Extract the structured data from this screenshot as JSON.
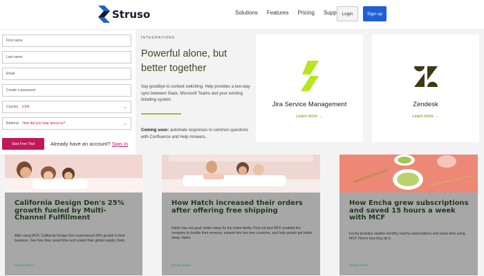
{
  "header": {
    "logo_text": "Struso",
    "nav": [
      "Solutions",
      "Features",
      "Pricing",
      "Support"
    ],
    "login_label": "Login",
    "signup_label": "Sign up"
  },
  "form": {
    "first_name_placeholder": "First name",
    "last_name_placeholder": "Last name",
    "email_placeholder": "Email",
    "password_placeholder": "Create a password",
    "country_label": "Country",
    "country_value": "USA",
    "referral_label": "Referral",
    "referral_value": "How did you hear about us?",
    "trial_button": "Start Free Trial",
    "account_prompt": "Already have an account?",
    "signin_link": "Sign In"
  },
  "integrations": {
    "eyebrow": "INTEGRATIONS",
    "headline": "Powerful alone, but better together",
    "paragraph": "Say goodbye to context switching. Help provides a two-way sync between Slack, Microsoft Teams and your existing ticketing system.",
    "coming_bold": "Coming soon:",
    "coming_rest": " automate responses to common questions with Confluence and Help Answers.",
    "cards": [
      {
        "name": "Jira Service Management",
        "link": "Learn more →"
      },
      {
        "name": "Zendesk",
        "link": "Learn more →"
      }
    ]
  },
  "case_studies": [
    {
      "title": "California Design Den's 25% growth fueled by Multi-Channel Fulfillment",
      "description": "After using MCF, California Design Den experienced 25% growth in their business. See how they saved time and scaled their global supply chain.",
      "link": "Read more ›"
    },
    {
      "title": "How Hatch increased their orders after offering free shipping",
      "description": "Hatch has one goal: better sleep for the entire family. Find out how MCF enabled the company to double their revenue, expand into two new countries, and help people get better sleep, faster.",
      "link": "Read more ›"
    },
    {
      "title": "How Encha grew subscriptions and saved 15 hours a week with MCF",
      "description": "Encha provides reliable monthly matcha subscriptions and saves time using MCF. Here's how they do it.",
      "link": "Read more ›"
    }
  ],
  "colors": {
    "brand_blue": "#1f5fd6",
    "trial_magenta": "#c2185b",
    "accent_green": "#9ac02e",
    "card_gray": "#a7a7a7"
  }
}
